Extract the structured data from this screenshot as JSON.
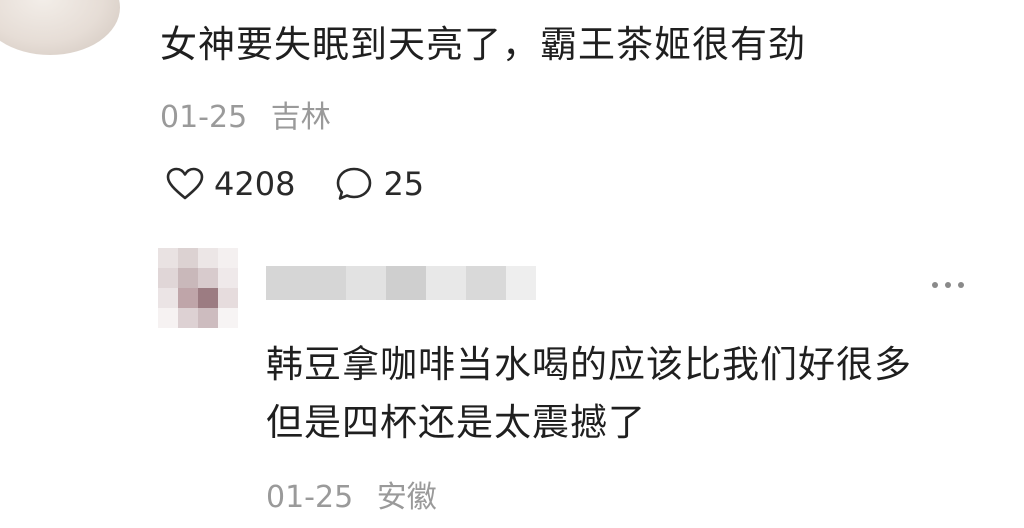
{
  "comment": {
    "text": "女神要失眠到天亮了，霸王茶姬很有劲",
    "date": "01-25",
    "location": "吉林",
    "likes": "4208",
    "replies": "25",
    "like_icon": "heart-outline-icon",
    "reply_icon": "speech-bubble-icon"
  },
  "reply": {
    "text_line1": "韩豆拿咖啡当水喝的应该比我们好很多",
    "text_line2": "但是四杯还是太震撼了",
    "date": "01-25",
    "location": "安徽",
    "more_icon": "more-options-icon"
  },
  "colors": {
    "text_primary": "#1f1f1f",
    "text_secondary": "#9a9a9a",
    "icon": "#2a2a2a"
  }
}
